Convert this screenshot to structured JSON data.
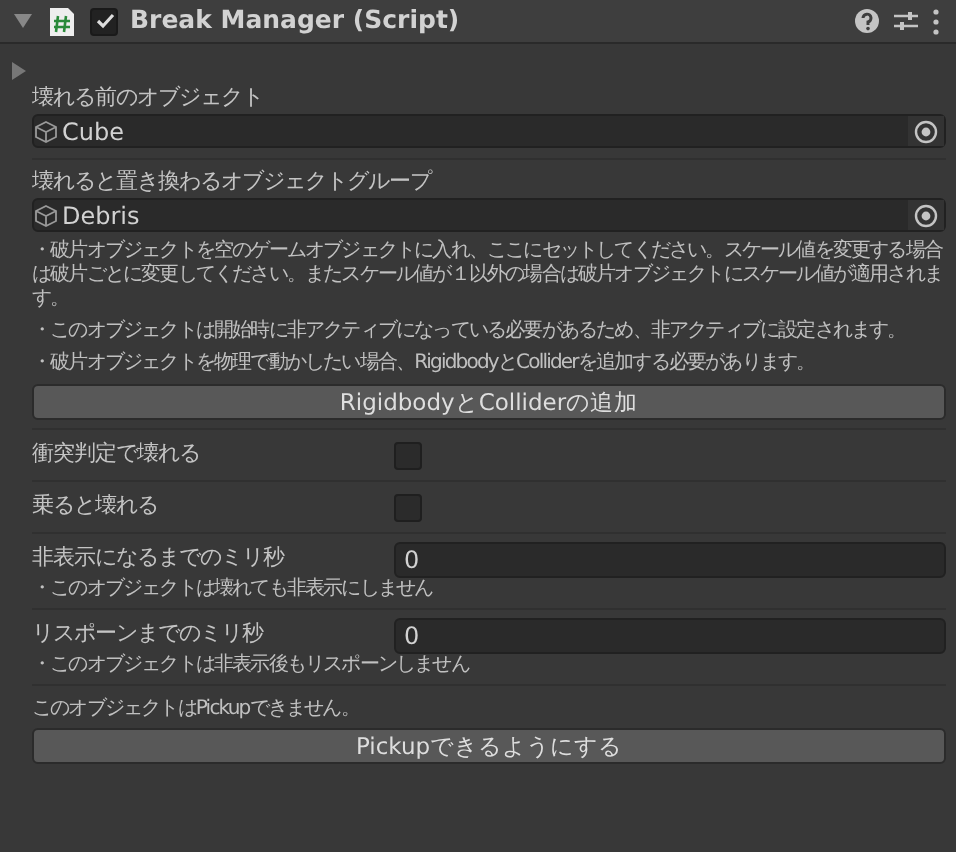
{
  "component": {
    "title": "Break Manager (Script)",
    "expanded": true,
    "enabled": true
  },
  "foldout": {
    "expanded": false
  },
  "items": [
    {
      "kind": "object",
      "label": "壊れる前のオブジェクト",
      "value": "Cube"
    },
    {
      "kind": "object",
      "label": "壊れると置き換わるオブジェクトグループ",
      "value": "Debris"
    },
    {
      "kind": "notes",
      "lines": [
        "・破片オブジェクトを空のゲームオブジェクトに入れ、ここにセットしてください。スケール値を変更する場合は破片ごとに変更してください。またスケール値が１以外の場合は破片オブジェクトにスケール値が適用されます。",
        "・このオブジェクトは開始時に非アクティブになっている必要があるため、非アクティブに設定されます。",
        "・破片オブジェクトを物理で動かしたい場合、RigidbodyとColliderを追加する必要があります。"
      ]
    },
    {
      "kind": "button",
      "label": "RigidbodyとColliderの追加"
    },
    {
      "kind": "toggle",
      "label": "衝突判定で壊れる",
      "checked": false
    },
    {
      "kind": "toggle",
      "label": "乗ると壊れる",
      "checked": false
    },
    {
      "kind": "number",
      "label": "非表示になるまでのミリ秒",
      "value": "0",
      "note": "・このオブジェクトは壊れても非表示にしません"
    },
    {
      "kind": "number",
      "label": "リスポーンまでのミリ秒",
      "value": "0",
      "note": "・このオブジェクトは非表示後もリスポーンしません"
    },
    {
      "kind": "message",
      "text": "このオブジェクトはPickupできません。"
    },
    {
      "kind": "button",
      "label": "Pickupできるようにする"
    }
  ]
}
